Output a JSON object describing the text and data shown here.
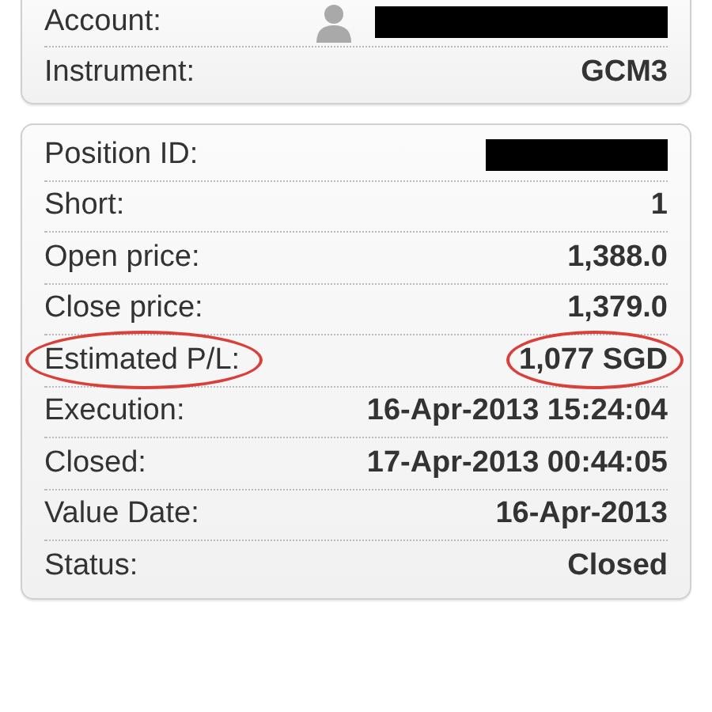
{
  "cards": [
    {
      "rows": [
        {
          "label": "Account:",
          "kind": "avatar_redacted",
          "circled": false
        },
        {
          "label": "Instrument:",
          "kind": "text",
          "value": "GCM3",
          "circled": false
        }
      ]
    },
    {
      "rows": [
        {
          "label": "Position ID:",
          "kind": "redacted",
          "circled": false
        },
        {
          "label": "Short:",
          "kind": "text",
          "value": "1",
          "circled": false
        },
        {
          "label": "Open price:",
          "kind": "text",
          "value": "1,388.0",
          "circled": false
        },
        {
          "label": "Close price:",
          "kind": "text",
          "value": "1,379.0",
          "circled": false
        },
        {
          "label": "Estimated P/L:",
          "kind": "text",
          "value": "1,077 SGD",
          "circled": true
        },
        {
          "label": "Execution:",
          "kind": "text",
          "value": "16-Apr-2013 15:24:04",
          "circled": false
        },
        {
          "label": "Closed:",
          "kind": "text",
          "value": "17-Apr-2013 00:44:05",
          "circled": false
        },
        {
          "label": "Value Date:",
          "kind": "text",
          "value": "16-Apr-2013",
          "circled": false
        },
        {
          "label": "Status:",
          "kind": "text",
          "value": "Closed",
          "circled": false
        }
      ]
    }
  ]
}
